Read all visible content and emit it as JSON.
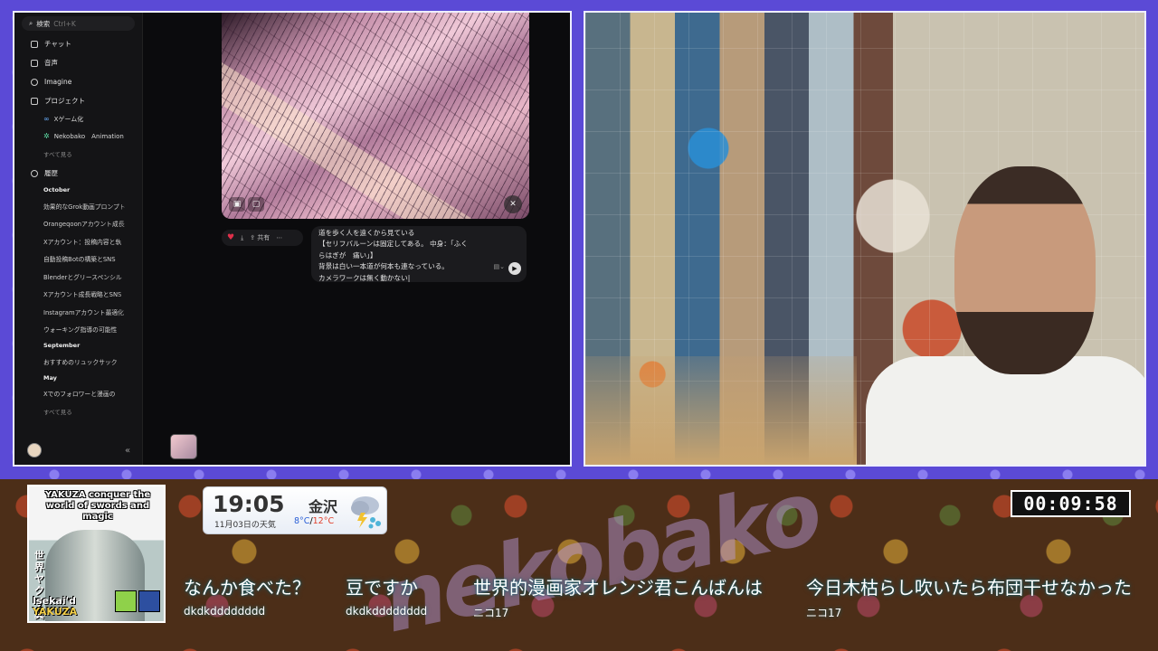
{
  "sidebar": {
    "search_label": "検索",
    "search_shortcut": "Ctrl+K",
    "nav": [
      {
        "label": "チャット",
        "icon": "chat-icon"
      },
      {
        "label": "音声",
        "icon": "voice-icon"
      },
      {
        "label": "Imagine",
        "icon": "imagine-icon"
      },
      {
        "label": "プロジェクト",
        "icon": "folder-icon"
      }
    ],
    "projects": [
      {
        "label": "Xゲーム化"
      },
      {
        "label": "Nekobako　Animation"
      }
    ],
    "projects_see_all": "すべて見る",
    "history_label": "履歴",
    "history_sections": [
      {
        "title": "October",
        "items": [
          "効果的なGrok動画プロンプト",
          "Orangeqoonアカウント成長",
          "Xアカウント：投稿内容と執",
          "自動投稿Botの構築とSNS",
          "Blenderとグリースペンシル",
          "Xアカウント成長戦略とSNS",
          "Instagramアカウント最適化",
          "ウォーキング指導の可能性"
        ]
      },
      {
        "title": "September",
        "items": [
          "おすすめのリュックサック"
        ]
      },
      {
        "title": "May",
        "items": [
          "Xでのフォロワーと漫画の"
        ]
      }
    ],
    "history_see_all": "すべて見る"
  },
  "post": {
    "share_label": "共有",
    "more_label": "⋯"
  },
  "prompt": {
    "lines": [
      "道を歩く人を遠くから見ている",
      "【セリフバルーンは固定してある。 中身：「ふく",
      "らはぎが　痛い」】",
      "背景は白い一本道が何本も連なっている。",
      "カメラワークは無く動かない|"
    ]
  },
  "overlay": {
    "cover": {
      "title": "YAKUZA conquer the world of swords and magic",
      "vertical": "世界ヤクザ異",
      "bottom1": "Isekai'd",
      "bottom2": "YAKUZA"
    },
    "weather": {
      "time": "19:05",
      "date": "11月03日の天気",
      "city": "金沢",
      "temp_high": "8°C",
      "temp_sep": "/",
      "temp_low": "12°C",
      "icon": "rain-cloud-icon"
    },
    "timer": "00:09:58",
    "chat": [
      {
        "msg": "なんか食べた？",
        "user": "dkdkdddddddd"
      },
      {
        "msg": "豆ですか",
        "user": "dkdkdddddddd"
      },
      {
        "msg": "世界的漫画家オレンジ君こんばんは",
        "user": "ニコ17"
      },
      {
        "msg": "今日木枯らし吹いたら布団干せなかった",
        "user": "ニコ17"
      }
    ]
  }
}
